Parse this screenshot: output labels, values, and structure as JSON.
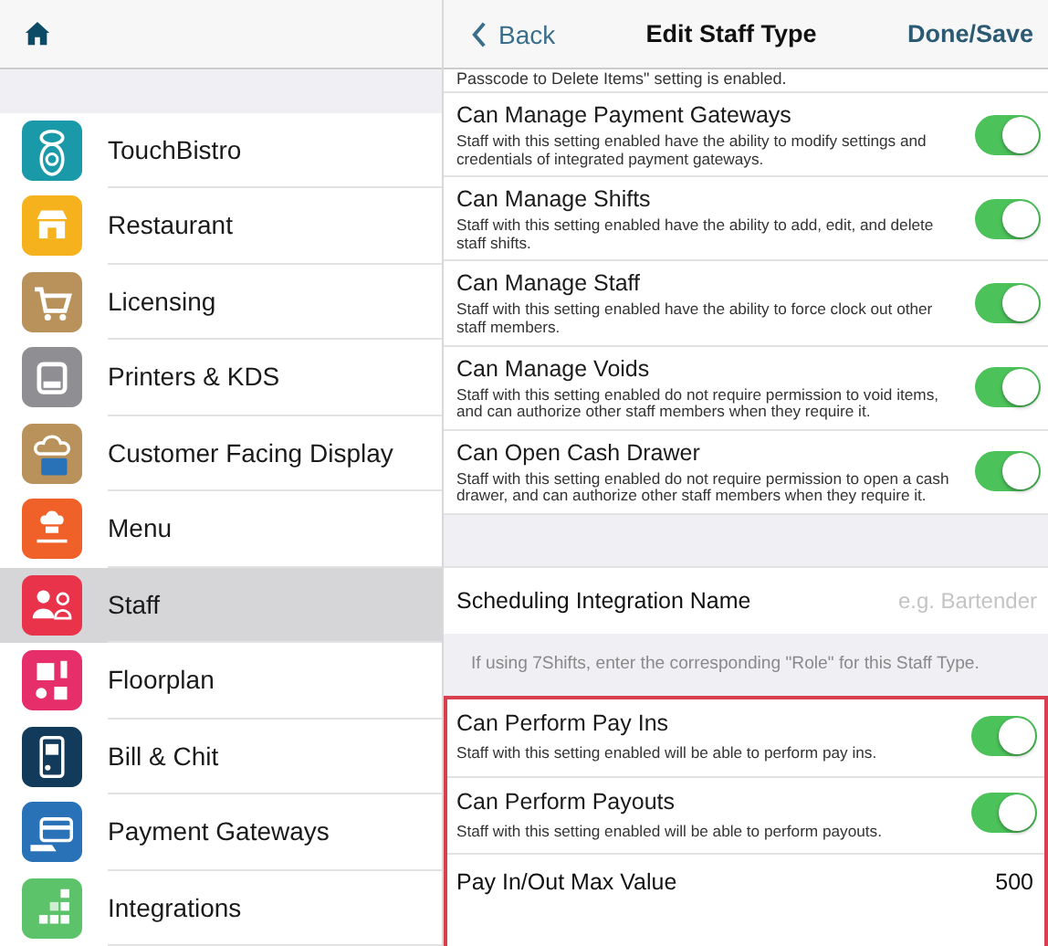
{
  "sidebar": {
    "items": [
      {
        "label": "TouchBistro",
        "selected": false,
        "color": "#1a9aa8"
      },
      {
        "label": "Restaurant",
        "selected": false,
        "color": "#f5b21c"
      },
      {
        "label": "Licensing",
        "selected": false,
        "color": "#b8925a"
      },
      {
        "label": "Printers & KDS",
        "selected": false,
        "color": "#8e8e93"
      },
      {
        "label": "Customer Facing Display",
        "selected": false,
        "color": "#b8925a"
      },
      {
        "label": "Menu",
        "selected": false,
        "color": "#f0612a"
      },
      {
        "label": "Staff",
        "selected": true,
        "color": "#e8334a"
      },
      {
        "label": "Floorplan",
        "selected": false,
        "color": "#e62f6a"
      },
      {
        "label": "Bill & Chit",
        "selected": false,
        "color": "#123a5a"
      },
      {
        "label": "Payment Gateways",
        "selected": false,
        "color": "#2a72b8"
      },
      {
        "label": "Integrations",
        "selected": false,
        "color": "#5cc36a"
      }
    ]
  },
  "nav": {
    "back": "Back",
    "title": "Edit Staff Type",
    "done": "Done/Save"
  },
  "clipped_note": "Passcode to Delete Items\" setting is enabled.",
  "settings": [
    {
      "title": "Can Manage Payment Gateways",
      "description": "Staff with this setting enabled have the ability to modify settings and credentials of integrated payment gateways.",
      "on": true
    },
    {
      "title": "Can Manage Shifts",
      "description": "Staff with this setting enabled have the ability to add, edit, and delete staff shifts.",
      "on": true
    },
    {
      "title": "Can Manage Staff",
      "description": "Staff with this setting enabled have the ability to force clock out other staff members.",
      "on": true
    },
    {
      "title": "Can Manage Voids",
      "description": "Staff with this setting enabled do not require permission to void items, and can authorize other staff members when they require it.",
      "on": true
    },
    {
      "title": "Can Open Cash Drawer",
      "description": "Staff with this setting enabled do not require permission to open a cash drawer, and can authorize other staff members when they require it.",
      "on": true
    }
  ],
  "scheduling": {
    "label": "Scheduling Integration Name",
    "placeholder": "e.g. Bartender",
    "hint": "If using 7Shifts, enter the corresponding \"Role\" for this Staff Type."
  },
  "highlighted": {
    "settings": [
      {
        "title": "Can Perform Pay Ins",
        "description": "Staff with this setting enabled will be able to perform pay ins.",
        "on": true
      },
      {
        "title": "Can Perform Payouts",
        "description": "Staff with this setting enabled will be able to perform payouts.",
        "on": true
      }
    ],
    "max_value": {
      "label": "Pay In/Out Max Value",
      "value": "500"
    }
  }
}
